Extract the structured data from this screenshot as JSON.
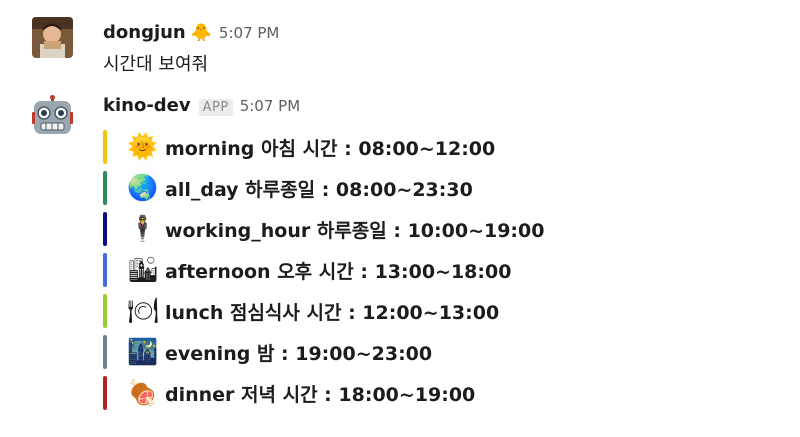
{
  "messages": [
    {
      "author": "dongjun",
      "status_emoji": "🐥",
      "time": "5:07 PM",
      "text": "시간대 보여줘"
    },
    {
      "author": "kino-dev",
      "app_badge": "APP",
      "time": "5:07 PM",
      "attachments": [
        {
          "emoji": "🌞",
          "color": "#f2c511",
          "text": "morning 아침 시간 : 08:00~12:00"
        },
        {
          "emoji": "🌏",
          "color": "#2e8b57",
          "text": "all_day 하루종일 : 08:00~23:30"
        },
        {
          "emoji": "🕴",
          "color": "#0b0b8a",
          "text": "working_hour 하루종일 : 10:00~19:00"
        },
        {
          "emoji": "🏙",
          "color": "#4169e1",
          "text": "afternoon 오후 시간 : 13:00~18:00"
        },
        {
          "emoji": "🍽",
          "color": "#9acd32",
          "text": "lunch 점심식사 시간 : 12:00~13:00"
        },
        {
          "emoji": "🌃",
          "color": "#708090",
          "text": "evening 밤 : 19:00~23:00"
        },
        {
          "emoji": "🍖",
          "color": "#b22222",
          "text": "dinner 저녁 시간 : 18:00~19:00"
        }
      ]
    }
  ]
}
